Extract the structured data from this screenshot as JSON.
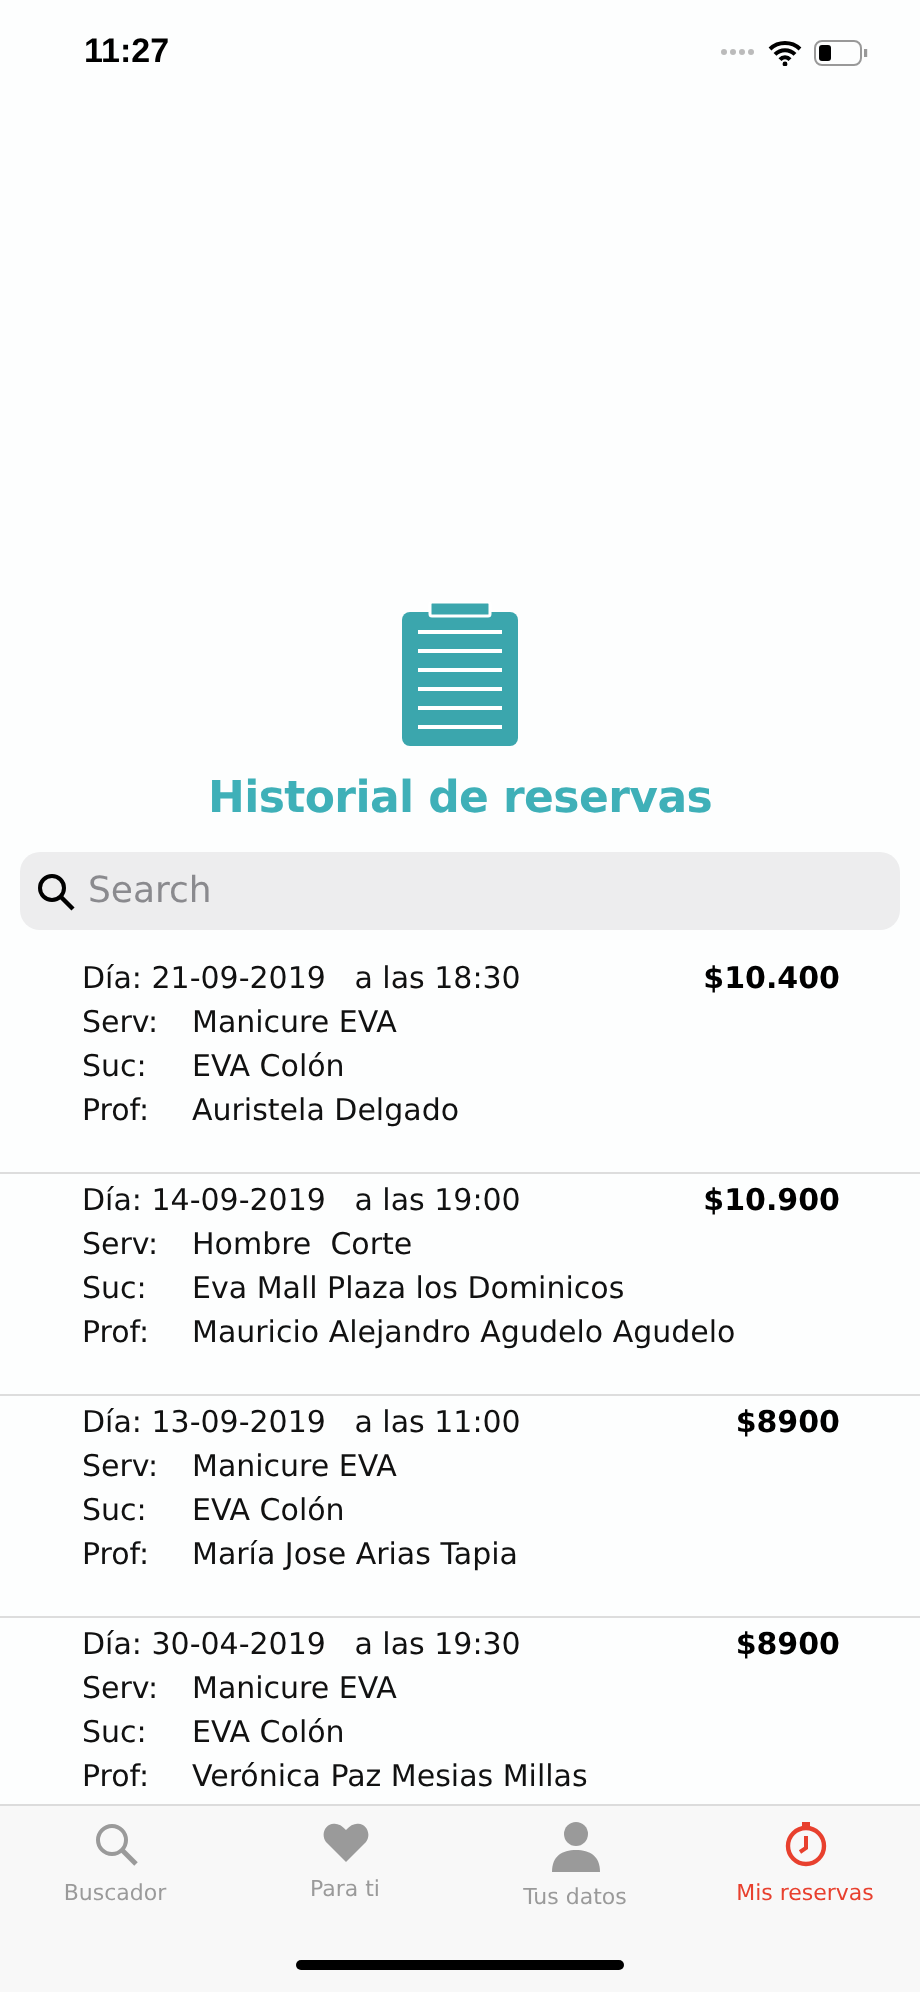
{
  "status_bar": {
    "time": "11:27"
  },
  "header": {
    "title": "Historial de reservas"
  },
  "search": {
    "placeholder": "Search"
  },
  "reservations": [
    {
      "day_label": "Día:",
      "date": "21-09-2019",
      "time_label": "a las",
      "time": "18:30",
      "price": "$10.400",
      "fields": [
        {
          "label": "Serv:",
          "value": "Manicure EVA"
        },
        {
          "label": "Suc:",
          "value": "EVA Colón"
        },
        {
          "label": "Prof:",
          "value": "Auristela Delgado"
        }
      ]
    },
    {
      "day_label": "Día:",
      "date": "14-09-2019",
      "time_label": "a las",
      "time": "19:00",
      "price": "$10.900",
      "fields": [
        {
          "label": "Serv:",
          "value": "Hombre  Corte"
        },
        {
          "label": "Suc:",
          "value": "Eva Mall Plaza los Dominicos"
        },
        {
          "label": "Prof:",
          "value": "Mauricio Alejandro Agudelo Agudelo"
        }
      ]
    },
    {
      "day_label": "Día:",
      "date": "13-09-2019",
      "time_label": "a las",
      "time": "11:00",
      "price": "$8900",
      "fields": [
        {
          "label": "Serv:",
          "value": "Manicure EVA"
        },
        {
          "label": "Suc:",
          "value": "EVA Colón"
        },
        {
          "label": "Prof:",
          "value": "María Jose Arias Tapia"
        }
      ]
    },
    {
      "day_label": "Día:",
      "date": "30-04-2019",
      "time_label": "a las",
      "time": "19:30",
      "price": "$8900",
      "fields": [
        {
          "label": "Serv:",
          "value": "Manicure EVA"
        },
        {
          "label": "Suc:",
          "value": "EVA Colón"
        },
        {
          "label": "Prof:",
          "value": "Verónica Paz Mesias Millas"
        }
      ]
    }
  ],
  "tab_bar": [
    {
      "label": "Buscador",
      "selected": false
    },
    {
      "label": "Para ti",
      "selected": false
    },
    {
      "label": "Tus datos",
      "selected": false
    },
    {
      "label": "Mis reservas",
      "selected": true
    }
  ]
}
